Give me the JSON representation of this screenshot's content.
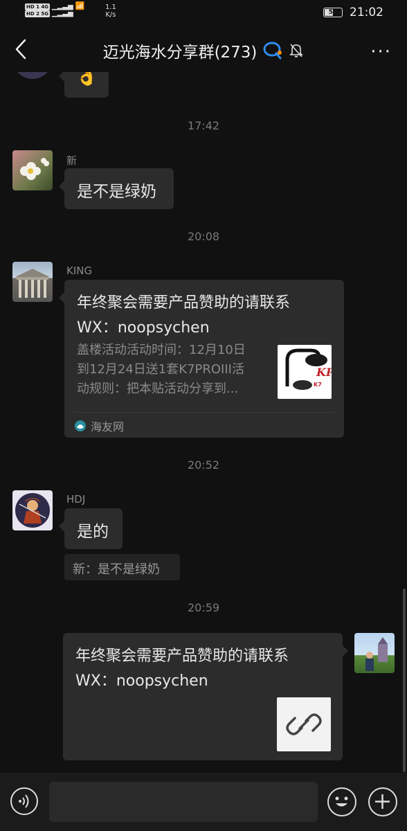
{
  "status_bar": {
    "network_left": "HD 1 4G",
    "network_left2": "HD 2 5G",
    "speed_value": "1.1",
    "speed_unit": "K/s",
    "battery": "51",
    "time": "21:02"
  },
  "header": {
    "title": "迈光海水分享群(273)",
    "more_label": "···"
  },
  "messages": [
    {
      "type": "emoji",
      "emoji": "👌"
    },
    {
      "type": "timestamp",
      "text": "17:42"
    },
    {
      "type": "text",
      "sender": "新",
      "text": "是不是绿奶"
    },
    {
      "type": "timestamp",
      "text": "20:08"
    },
    {
      "type": "link_card",
      "sender": "KING",
      "title": "年终聚会需要产品赞助的请联系WX：noopsychen",
      "title_line1": "年终聚会需要产品赞助的请联系",
      "title_line2": "WX：noopsychen",
      "desc_lines": [
        "盖楼活动活动时间：12月10日",
        "到12月24日送1套K7PROIII活",
        "动规则：把本贴活动分享到..."
      ],
      "thumb_brand": "K7",
      "source": "海友网"
    },
    {
      "type": "timestamp",
      "text": "20:52"
    },
    {
      "type": "text",
      "sender": "HDJ",
      "text": "是的",
      "quote": "新：是不是绿奶"
    },
    {
      "type": "timestamp",
      "text": "20:59"
    },
    {
      "type": "self_text_link",
      "line1": "年终聚会需要产品赞助的请联系",
      "line2": "WX：noopsychen"
    }
  ],
  "input": {
    "placeholder": ""
  },
  "icons": {
    "back": "back-arrow-icon",
    "group_badge": "chat-bubble-icon",
    "mute": "mute-bell-icon",
    "more": "more-dots-icon",
    "voice": "voice-icon",
    "emoji": "emoji-icon",
    "plus": "plus-icon",
    "link": "link-icon"
  },
  "colors": {
    "background": "#111111",
    "bubble": "#2c2c2c",
    "timestamp": "#7a7a7a",
    "badge_blue": "#2f8cf0",
    "badge_orange": "#ff8a00"
  }
}
